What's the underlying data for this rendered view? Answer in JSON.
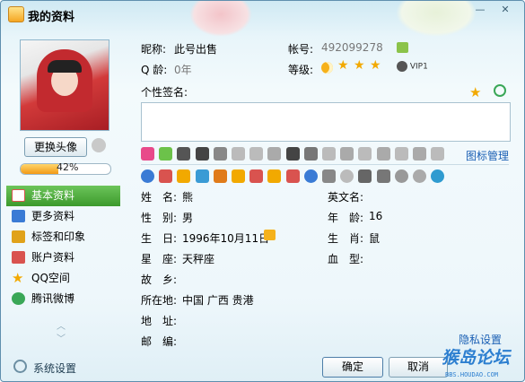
{
  "window": {
    "title": "我的资料",
    "min_icon": "minimize-icon",
    "close_icon": "close-icon"
  },
  "left": {
    "change_avatar_label": "更换头像",
    "progress_text": "42%",
    "progress_value": 0.42,
    "nav_items": [
      {
        "label": "基本资料",
        "icon": "profile-card-icon",
        "active": true,
        "color": "#d9534f"
      },
      {
        "label": "更多资料",
        "icon": "more-info-icon",
        "active": false,
        "color": "#3a7bd5"
      },
      {
        "label": "标签和印象",
        "icon": "tag-icon",
        "active": false,
        "color": "#e0a21a"
      },
      {
        "label": "账户资料",
        "icon": "account-icon",
        "active": false,
        "color": "#d9534f"
      },
      {
        "label": "QQ空间",
        "icon": "star-icon",
        "active": false,
        "color": "#f2a900"
      },
      {
        "label": "腾讯微博",
        "icon": "weibo-icon",
        "active": false,
        "color": "#3aa757"
      }
    ]
  },
  "profile": {
    "nickname_label": "昵称:",
    "nickname_value": "此号出售",
    "account_label": "帐号:",
    "account_value": "492099278",
    "qage_label": "Q 龄:",
    "qage_value": "0年",
    "level_label": "等级:",
    "vip_text": "VIP1",
    "signature_label": "个性签名:",
    "icon_manage_label": "图标管理",
    "fields_left": [
      {
        "label": "姓　名:",
        "value": "熊"
      },
      {
        "label": "性　别:",
        "value": "男"
      },
      {
        "label": "生　日:",
        "value": "1996年10月11日"
      },
      {
        "label": "星　座:",
        "value": "天秤座"
      },
      {
        "label": "故　乡:",
        "value": ""
      },
      {
        "label": "所在地:",
        "value": "中国 广西 贵港"
      },
      {
        "label": "地　址:",
        "value": ""
      },
      {
        "label": "邮　编:",
        "value": ""
      }
    ],
    "fields_right": [
      {
        "label": "英文名:",
        "value": ""
      },
      {
        "label": "年　龄:",
        "value": "16"
      },
      {
        "label": "生　肖:",
        "value": "鼠"
      },
      {
        "label": "血　型:",
        "value": ""
      }
    ],
    "privacy_label": "隐私设置"
  },
  "bottom": {
    "settings_label": "系统设置",
    "ok_label": "确定",
    "cancel_label": "取消",
    "watermark": "猴岛论坛",
    "watermark_sub": "BBS.HOUDAO.COM"
  },
  "colors": {
    "accent_green": "#3c9a2c",
    "link_blue": "#1a5fb4",
    "progress_orange": "#f29a16"
  }
}
